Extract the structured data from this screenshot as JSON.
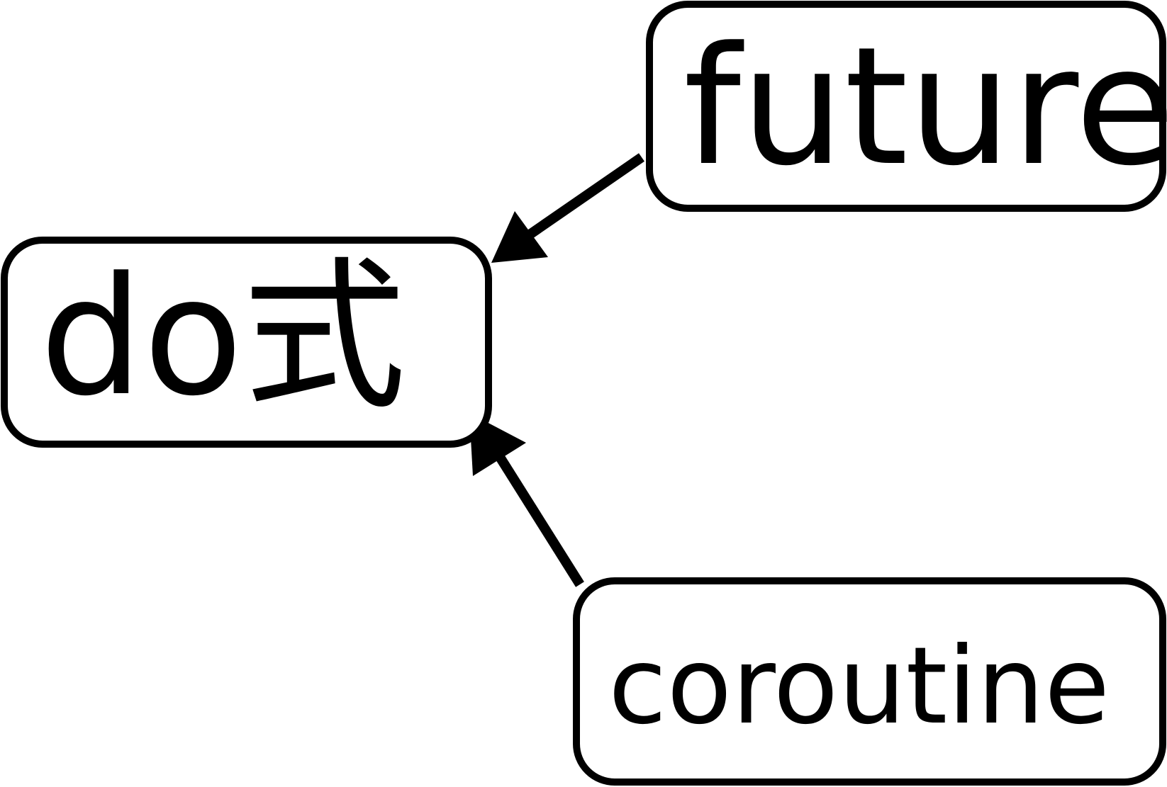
{
  "diagram": {
    "nodes": [
      {
        "id": "do",
        "label": "do式"
      },
      {
        "id": "future",
        "label": "future"
      },
      {
        "id": "coroutine",
        "label": "coroutine"
      }
    ],
    "edges": [
      {
        "from": "future",
        "to": "do"
      },
      {
        "from": "coroutine",
        "to": "do"
      }
    ]
  },
  "colors": {
    "stroke": "#000000",
    "fill": "#ffffff",
    "text": "#000000"
  }
}
